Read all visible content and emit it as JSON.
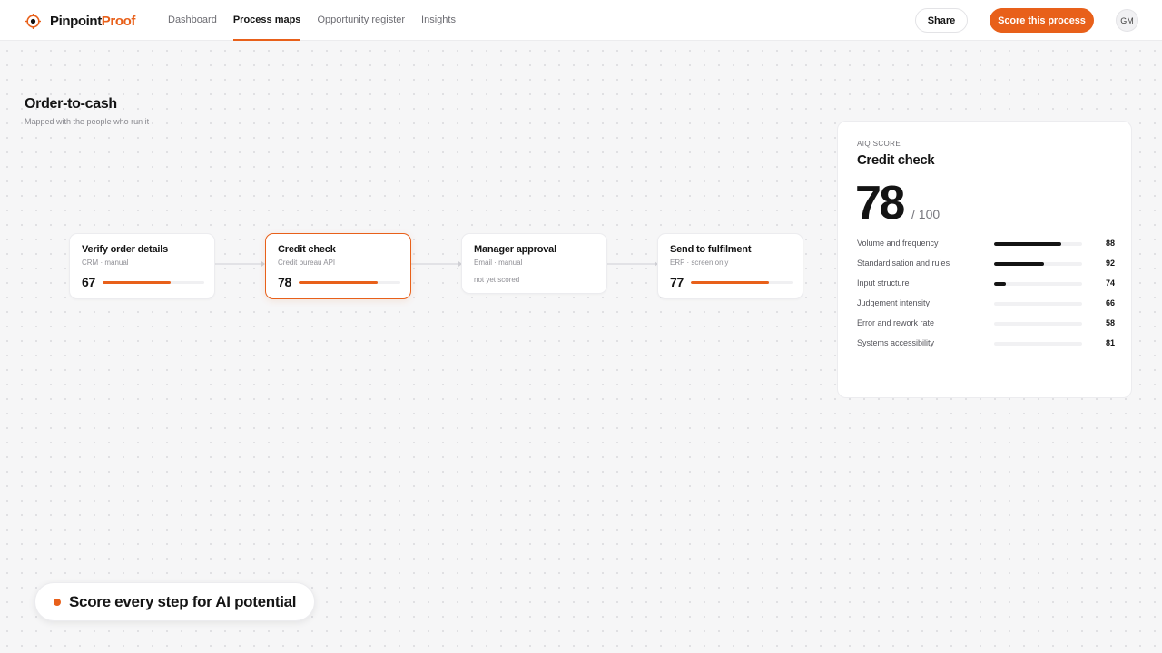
{
  "brand": {
    "name_part1": "Pinpoint",
    "name_part2": "Proof",
    "accent": "#e8601a"
  },
  "nav": {
    "tabs": [
      {
        "label": "Dashboard",
        "active": false
      },
      {
        "label": "Process maps",
        "active": true
      },
      {
        "label": "Opportunity register",
        "active": false
      },
      {
        "label": "Insights",
        "active": false
      }
    ]
  },
  "header": {
    "share_label": "Share",
    "score_label": "Score this process",
    "avatar_initials": "GM"
  },
  "page": {
    "title": "Order-to-cash",
    "subtitle": "Mapped with the people who run it"
  },
  "steps": [
    {
      "title": "Verify order details",
      "meta": "CRM · manual",
      "score": "67",
      "progress": 0.67,
      "selected": false
    },
    {
      "title": "Credit check",
      "meta": "Credit bureau API",
      "score": "78",
      "progress": 0.78,
      "selected": true
    },
    {
      "title": "Manager approval",
      "meta": "Email · manual",
      "note": "not yet scored",
      "selected": false
    },
    {
      "title": "Send to fulfilment",
      "meta": "ERP · screen only",
      "score": "77",
      "progress": 0.77,
      "selected": false
    }
  ],
  "panel": {
    "eyebrow": "AIQ SCORE",
    "title": "Credit check",
    "score": "78",
    "out_of": "/ 100",
    "metrics": [
      {
        "label": "Volume and frequency",
        "value": "88",
        "level": 0.76
      },
      {
        "label": "Standardisation and rules",
        "value": "92",
        "level": 0.57
      },
      {
        "label": "Input structure",
        "value": "74",
        "level": 0.13
      },
      {
        "label": "Judgement intensity",
        "value": "66",
        "level": 0
      },
      {
        "label": "Error and rework rate",
        "value": "58",
        "level": 0
      },
      {
        "label": "Systems accessibility",
        "value": "81",
        "level": 0
      }
    ]
  },
  "callout": {
    "text": "Score every step for AI potential"
  }
}
